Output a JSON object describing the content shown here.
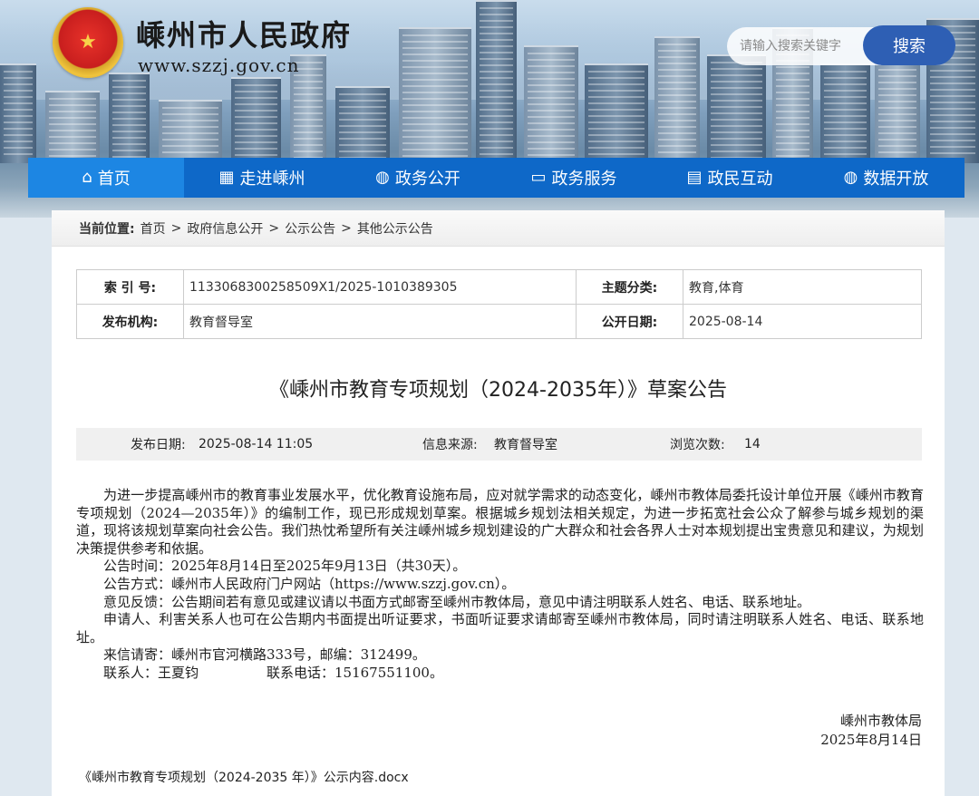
{
  "header": {
    "site_title": "嵊州市人民政府",
    "site_url": "www.szzj.gov.cn",
    "search_placeholder": "请输入搜索关键字",
    "search_button": "搜索"
  },
  "nav": [
    {
      "label": "首页",
      "icon": "home-icon",
      "glyph": "⌂",
      "active": true
    },
    {
      "label": "走进嵊州",
      "icon": "building-icon",
      "glyph": "▦"
    },
    {
      "label": "政务公开",
      "icon": "globe-icon",
      "glyph": "◍"
    },
    {
      "label": "政务服务",
      "icon": "monitor-icon",
      "glyph": "▭"
    },
    {
      "label": "政民互动",
      "icon": "chat-icon",
      "glyph": "▤"
    },
    {
      "label": "数据开放",
      "icon": "globe-icon",
      "glyph": "◍"
    }
  ],
  "breadcrumb": {
    "label": "当前位置:",
    "items": [
      "首页",
      "政府信息公开",
      "公示公告",
      "其他公示公告"
    ],
    "separator": ">"
  },
  "meta": {
    "index_label": "索 引 号:",
    "index_value": "1133068300258509X1/2025-1010389305",
    "topic_label": "主题分类:",
    "topic_value": "教育,体育",
    "org_label": "发布机构:",
    "org_value": "教育督导室",
    "date_label": "公开日期:",
    "date_value": "2025-08-14"
  },
  "article": {
    "title": "《嵊州市教育专项规划（2024-2035年）》草案公告",
    "publish_label": "发布日期:",
    "publish_value": "2025-08-14 11:05",
    "source_label": "信息来源:",
    "source_value": "教育督导室",
    "views_label": "浏览次数:",
    "views_value": "14",
    "paragraphs": [
      "为进一步提高嵊州市的教育事业发展水平，优化教育设施布局，应对就学需求的动态变化，嵊州市教体局委托设计单位开展《嵊州市教育专项规划（2024—2035年）》的编制工作，现已形成规划草案。根据城乡规划法相关规定，为进一步拓宽社会公众了解参与城乡规划的渠道，现将该规划草案向社会公告。我们热忱希望所有关注嵊州城乡规划建设的广大群众和社会各界人士对本规划提出宝贵意见和建议，为规划决策提供参考和依据。",
      "公告时间：2025年8月14日至2025年9月13日（共30天）。",
      "公告方式：嵊州市人民政府门户网站（https://www.szzj.gov.cn）。",
      "意见反馈：公告期间若有意见或建议请以书面方式邮寄至嵊州市教体局，意见中请注明联系人姓名、电话、联系地址。",
      "申请人、利害关系人也可在公告期内书面提出听证要求，书面听证要求请邮寄至嵊州市教体局，同时请注明联系人姓名、电话、联系地址。",
      "来信请寄：嵊州市官河横路333号，邮编：312499。",
      "联系人：王夏钧　　　　　联系电话：15167551100。"
    ],
    "sign_org": "嵊州市教体局",
    "sign_date": "2025年8月14日",
    "attachment": "《嵊州市教育专项规划（2024-2035 年）》公示内容.docx"
  }
}
